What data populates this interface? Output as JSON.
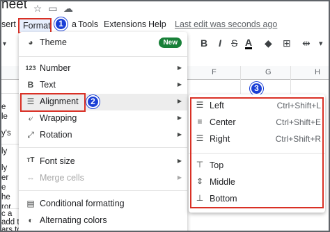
{
  "title": {
    "text": "heet"
  },
  "menu": {
    "partial_left": "sert",
    "format": "Format",
    "partial_a": "a",
    "tools": "Tools",
    "extensions": "Extensions",
    "help": "Help",
    "last_edit": "Last edit was seconds ago"
  },
  "toolbar": {
    "bold": "B",
    "italic": "I",
    "strike": "S",
    "text_color": "A"
  },
  "grid": {
    "columns": [
      "F",
      "G",
      "H"
    ],
    "cell_snippets": [
      "e",
      "le",
      "y's",
      "ly",
      "ly",
      "er",
      "e",
      "he",
      "ror",
      "o",
      "c a",
      "add th",
      "ars to"
    ]
  },
  "annotations": {
    "step1": "1",
    "step2": "2",
    "step3": "3"
  },
  "format_menu": {
    "theme": {
      "label": "Theme",
      "badge": "New",
      "icon": "palette-icon"
    },
    "items": [
      {
        "label": "Number",
        "icon": "number-format-icon",
        "shortcut_text": "123"
      },
      {
        "label": "Text",
        "icon": "bold-text-icon"
      },
      {
        "label": "Alignment",
        "icon": "align-left-icon"
      },
      {
        "label": "Wrapping",
        "icon": "wrap-text-icon"
      },
      {
        "label": "Rotation",
        "icon": "text-rotation-icon"
      }
    ],
    "font_size": {
      "label": "Font size",
      "icon": "font-size-icon"
    },
    "merge_cells": {
      "label": "Merge cells",
      "icon": "merge-cells-icon",
      "disabled": true
    },
    "conditional_formatting": {
      "label": "Conditional formatting",
      "icon": "paint-roller-icon"
    },
    "alternating_colors": {
      "label": "Alternating colors",
      "icon": "color-drop-icon"
    }
  },
  "alignment_menu": {
    "horizontal": [
      {
        "label": "Left",
        "shortcut": "Ctrl+Shift+L",
        "icon": "align-left-icon"
      },
      {
        "label": "Center",
        "shortcut": "Ctrl+Shift+E",
        "icon": "align-center-icon"
      },
      {
        "label": "Right",
        "shortcut": "Ctrl+Shift+R",
        "icon": "align-right-icon"
      }
    ],
    "vertical": [
      {
        "label": "Top",
        "icon": "align-top-icon"
      },
      {
        "label": "Middle",
        "icon": "align-middle-icon"
      },
      {
        "label": "Bottom",
        "icon": "align-bottom-icon"
      }
    ]
  },
  "colors": {
    "highlight_red": "#d93025",
    "badge_blue": "#1a3fd6",
    "new_green": "#188038"
  }
}
